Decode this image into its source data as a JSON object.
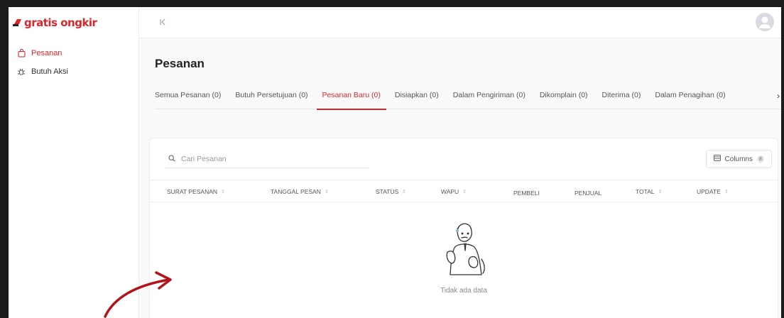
{
  "app": {
    "logo_text": "gratis ongkir",
    "brand_color": "#d9262b"
  },
  "sidebar": {
    "items": [
      {
        "label": "Pesanan",
        "icon": "bag-icon",
        "active": true
      },
      {
        "label": "Butuh Aksi",
        "icon": "bug-icon",
        "active": false
      }
    ]
  },
  "topbar": {
    "collapse_icon": "collapse-left-icon",
    "avatar_icon": "user-avatar-icon"
  },
  "page": {
    "title": "Pesanan"
  },
  "tabs": [
    {
      "label": "Semua Pesanan (0)",
      "active": false
    },
    {
      "label": "Butuh Persetujuan (0)",
      "active": false
    },
    {
      "label": "Pesanan Baru (0)",
      "active": true
    },
    {
      "label": "Disiapkan (0)",
      "active": false
    },
    {
      "label": "Dalam Pengiriman (0)",
      "active": false
    },
    {
      "label": "Dikomplain (0)",
      "active": false
    },
    {
      "label": "Diterima (0)",
      "active": false
    },
    {
      "label": "Dalam Penagihan (0)",
      "active": false
    }
  ],
  "search": {
    "placeholder": "Cari Pesanan",
    "value": ""
  },
  "columns_button": {
    "label": "Columns",
    "count": "8"
  },
  "table": {
    "headers": [
      {
        "label": "SURAT PESANAN",
        "sortable": true
      },
      {
        "label": "TANGGAL PESAN",
        "sortable": true
      },
      {
        "label": "STATUS",
        "sortable": true
      },
      {
        "label": "WAPU",
        "sortable": true
      },
      {
        "label": "PEMBELI",
        "sortable": false
      },
      {
        "label": "PENJUAL",
        "sortable": false
      },
      {
        "label": "TOTAL",
        "sortable": true
      },
      {
        "label": "UPDATE",
        "sortable": true
      }
    ],
    "empty_text": "Tidak ada data"
  }
}
